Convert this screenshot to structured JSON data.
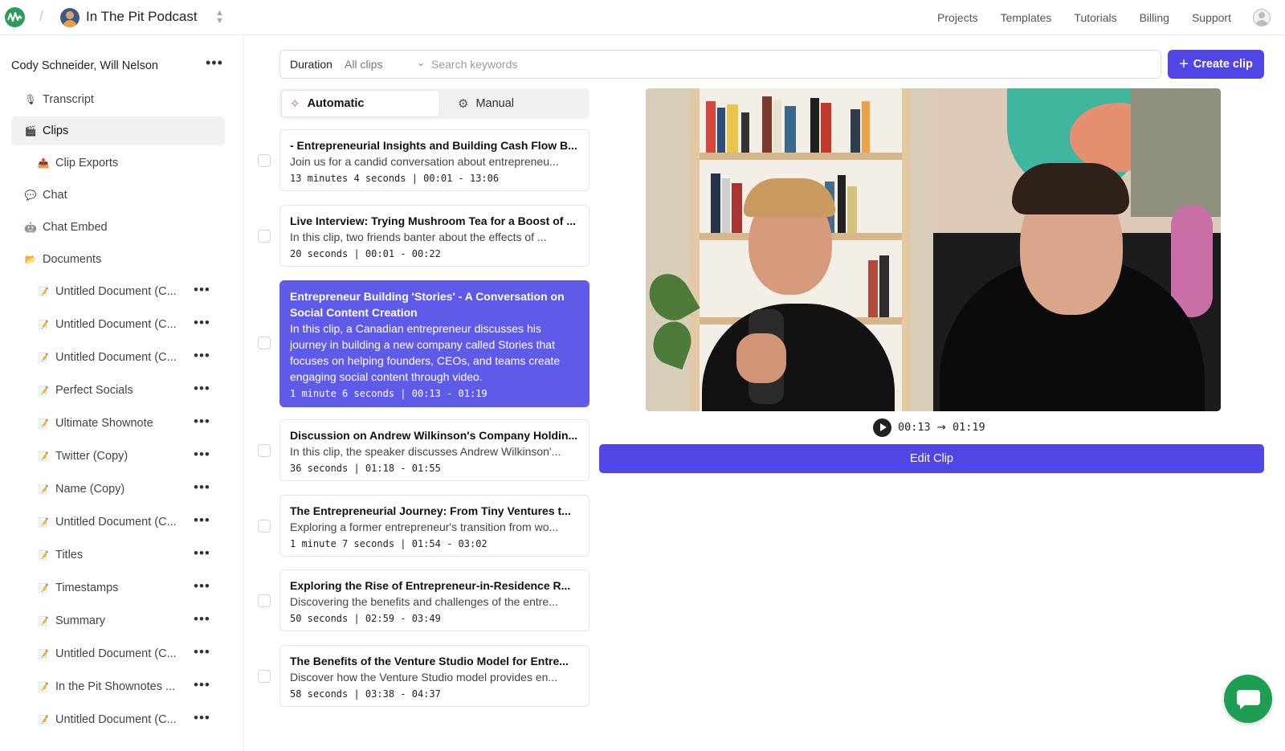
{
  "header": {
    "project_name": "In The Pit Podcast",
    "nav": [
      "Projects",
      "Templates",
      "Tutorials",
      "Billing",
      "Support"
    ]
  },
  "sidebar": {
    "title": "Cody Schneider, Will Nelson",
    "items": [
      {
        "label": "Transcript",
        "icon": "microphone-icon",
        "glyph": "🎙"
      },
      {
        "label": "Clips",
        "icon": "clapper-icon",
        "glyph": "🎬",
        "active": true
      },
      {
        "label": "Clip Exports",
        "icon": "export-icon",
        "glyph": "📤",
        "sub": true
      },
      {
        "label": "Chat",
        "icon": "chat-icon",
        "glyph": "💬"
      },
      {
        "label": "Chat Embed",
        "icon": "robot-icon",
        "glyph": "🤖"
      },
      {
        "label": "Documents",
        "icon": "folder-icon",
        "glyph": "📂"
      }
    ],
    "documents": [
      "Untitled Document (C...",
      "Untitled Document (C...",
      "Untitled Document (C...",
      "Perfect Socials",
      "Ultimate Shownote",
      "Twitter (Copy)",
      "Name (Copy)",
      "Untitled Document (C...",
      "Titles",
      "Timestamps",
      "Summary",
      "Untitled Document (C...",
      "In the Pit Shownotes ...",
      "Untitled Document (C..."
    ]
  },
  "filter": {
    "duration_label": "Duration",
    "duration_value": "All clips",
    "search_placeholder": "Search keywords",
    "create_label": "Create clip"
  },
  "tabs": {
    "automatic": "Automatic",
    "manual": "Manual"
  },
  "clips": [
    {
      "title": "- Entrepreneurial Insights and Building Cash Flow B...",
      "desc": "Join us for a candid conversation about entrepreneu...",
      "meta": "13 minutes 4 seconds | 00:01 - 13:06"
    },
    {
      "title": "Live Interview: Trying Mushroom Tea for a Boost of ...",
      "desc": "In this clip, two friends banter about the effects of ...",
      "meta": "20 seconds | 00:01 - 00:22"
    },
    {
      "title": "Entrepreneur Building 'Stories' - A Conversation on Social Content Creation",
      "desc": "In this clip, a Canadian entrepreneur discusses his journey in building a new company called Stories that focuses on helping founders, CEOs, and teams create engaging social content through video.",
      "meta": "1 minute 6 seconds | 00:13 - 01:19",
      "selected": true
    },
    {
      "title": "Discussion on Andrew Wilkinson's Company Holdin...",
      "desc": "In this clip, the speaker discusses Andrew Wilkinson'...",
      "meta": "36 seconds | 01:18 - 01:55"
    },
    {
      "title": "The Entrepreneurial Journey: From Tiny Ventures t...",
      "desc": "Exploring a former entrepreneur's transition from wo...",
      "meta": "1 minute 7 seconds | 01:54 - 03:02"
    },
    {
      "title": "Exploring the Rise of Entrepreneur-in-Residence R...",
      "desc": "Discovering the benefits and challenges of the entre...",
      "meta": "50 seconds | 02:59 - 03:49"
    },
    {
      "title": "The Benefits of the Venture Studio Model for Entre...",
      "desc": "Discover how the Venture Studio model provides en...",
      "meta": "58 seconds | 03:38 - 04:37"
    }
  ],
  "player": {
    "start": "00:13",
    "end": "01:19",
    "edit_label": "Edit Clip"
  },
  "colors": {
    "accent": "#4f46e5",
    "selected_clip": "#5f5ae8",
    "brand_green": "#1f9d52"
  }
}
